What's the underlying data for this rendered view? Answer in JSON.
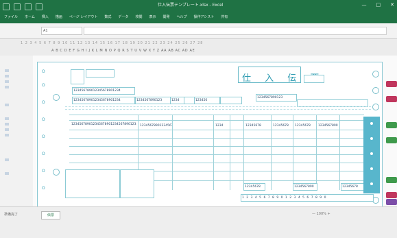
{
  "window": {
    "title": "仕入伝票テンプレート.xlsx - Excel",
    "controls": [
      "—",
      "□",
      "✕"
    ]
  },
  "ribbon": {
    "tabs": [
      "ファイル",
      "ホーム",
      "挿入",
      "描画",
      "ページ レイアウト",
      "数式",
      "データ",
      "校閲",
      "表示",
      "開発",
      "ヘルプ",
      "操作アシスト",
      "共有"
    ]
  },
  "formula_bar": {
    "name_box": "A1",
    "formula": ""
  },
  "ruler": {
    "top_text": "1 2 3 4 5 6 7 8 9 10 11 12 13 14 15 16 17 18 19 20 21 22 23 24 25 26 27 28",
    "column_headers": "A B C D E F G H I J K L M N O P Q R S T U V W X Y Z AA AB AC AD AE"
  },
  "form": {
    "title": "仕 入 伝 票",
    "subtitle": "仕入伝票",
    "codes": {
      "c1": "123456789012345678901234",
      "c2": "123456789012345678901234",
      "c3": "1234567890123",
      "c4": "123456",
      "c5": "1234",
      "c6": "1234567890",
      "c7": "12345678901234567890",
      "c8": "1234567890123",
      "c9": "12345678901234567890123456789012345678901234",
      "c10": "12345678901234567890",
      "qty": "1234",
      "unit": "12345678",
      "price1": "12345678",
      "price2": "12345678",
      "amount": "1234567890",
      "total1": "12345678",
      "total2": "1234567890",
      "total3": "12345678",
      "footer": "1 2 3 4 5 6 7 8 9 0 1 2 3 4 5 6 7 8 9 0"
    },
    "marks": [
      "O",
      "O",
      "O",
      "O",
      "O",
      "O",
      "O",
      "O",
      "O",
      "O"
    ]
  },
  "status": {
    "left": "準備完了",
    "sheet_tab": "伝票",
    "right": "—  100%  +"
  },
  "colors": {
    "excel_green": "#1f7244",
    "form_teal": "#3aa3b7",
    "panel_blue": "#58b6cc",
    "btn_red": "#c0365d",
    "btn_green": "#3f9a4c",
    "btn_purple": "#7c4ea8"
  },
  "icons": [
    "save-icon",
    "undo-icon",
    "redo-icon",
    "print-icon",
    "minimize-icon",
    "maximize-icon",
    "close-icon"
  ]
}
